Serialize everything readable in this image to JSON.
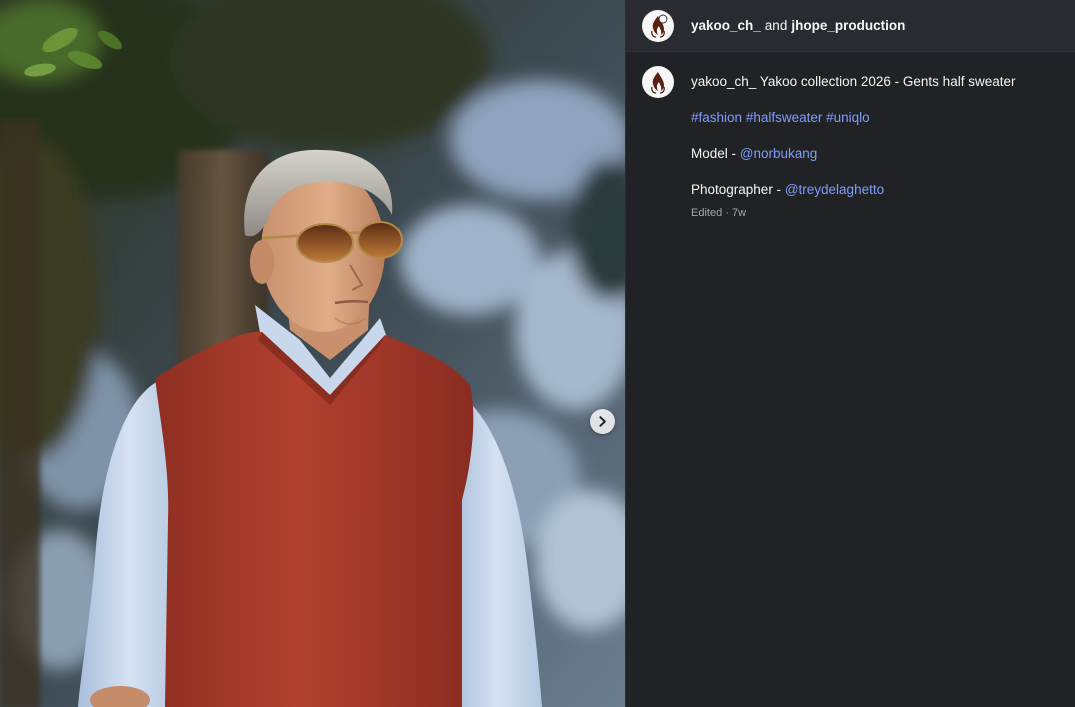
{
  "header": {
    "user_one": "yakoo_ch_",
    "conjunction": "and",
    "user_two": "jhope_production"
  },
  "caption": {
    "username": "yakoo_ch_",
    "title": "Yakoo collection 2026 - Gents half sweater",
    "hashtags": [
      "#fashion",
      "#halfsweater",
      "#uniqlo"
    ],
    "model_label": "Model -",
    "model_handle": "@norbukang",
    "photographer_label": "Photographer -",
    "photographer_handle": "@treydelaghetto",
    "meta": "Edited · 7w"
  },
  "icons": {
    "avatar": "flame-logo-icon",
    "next": "chevron-right-icon"
  },
  "colors": {
    "panel_bg": "#202226",
    "header_bg": "#2a2b30",
    "link": "#7e9ef8",
    "text": "#f5f5f5",
    "muted": "#a8a8a8"
  }
}
